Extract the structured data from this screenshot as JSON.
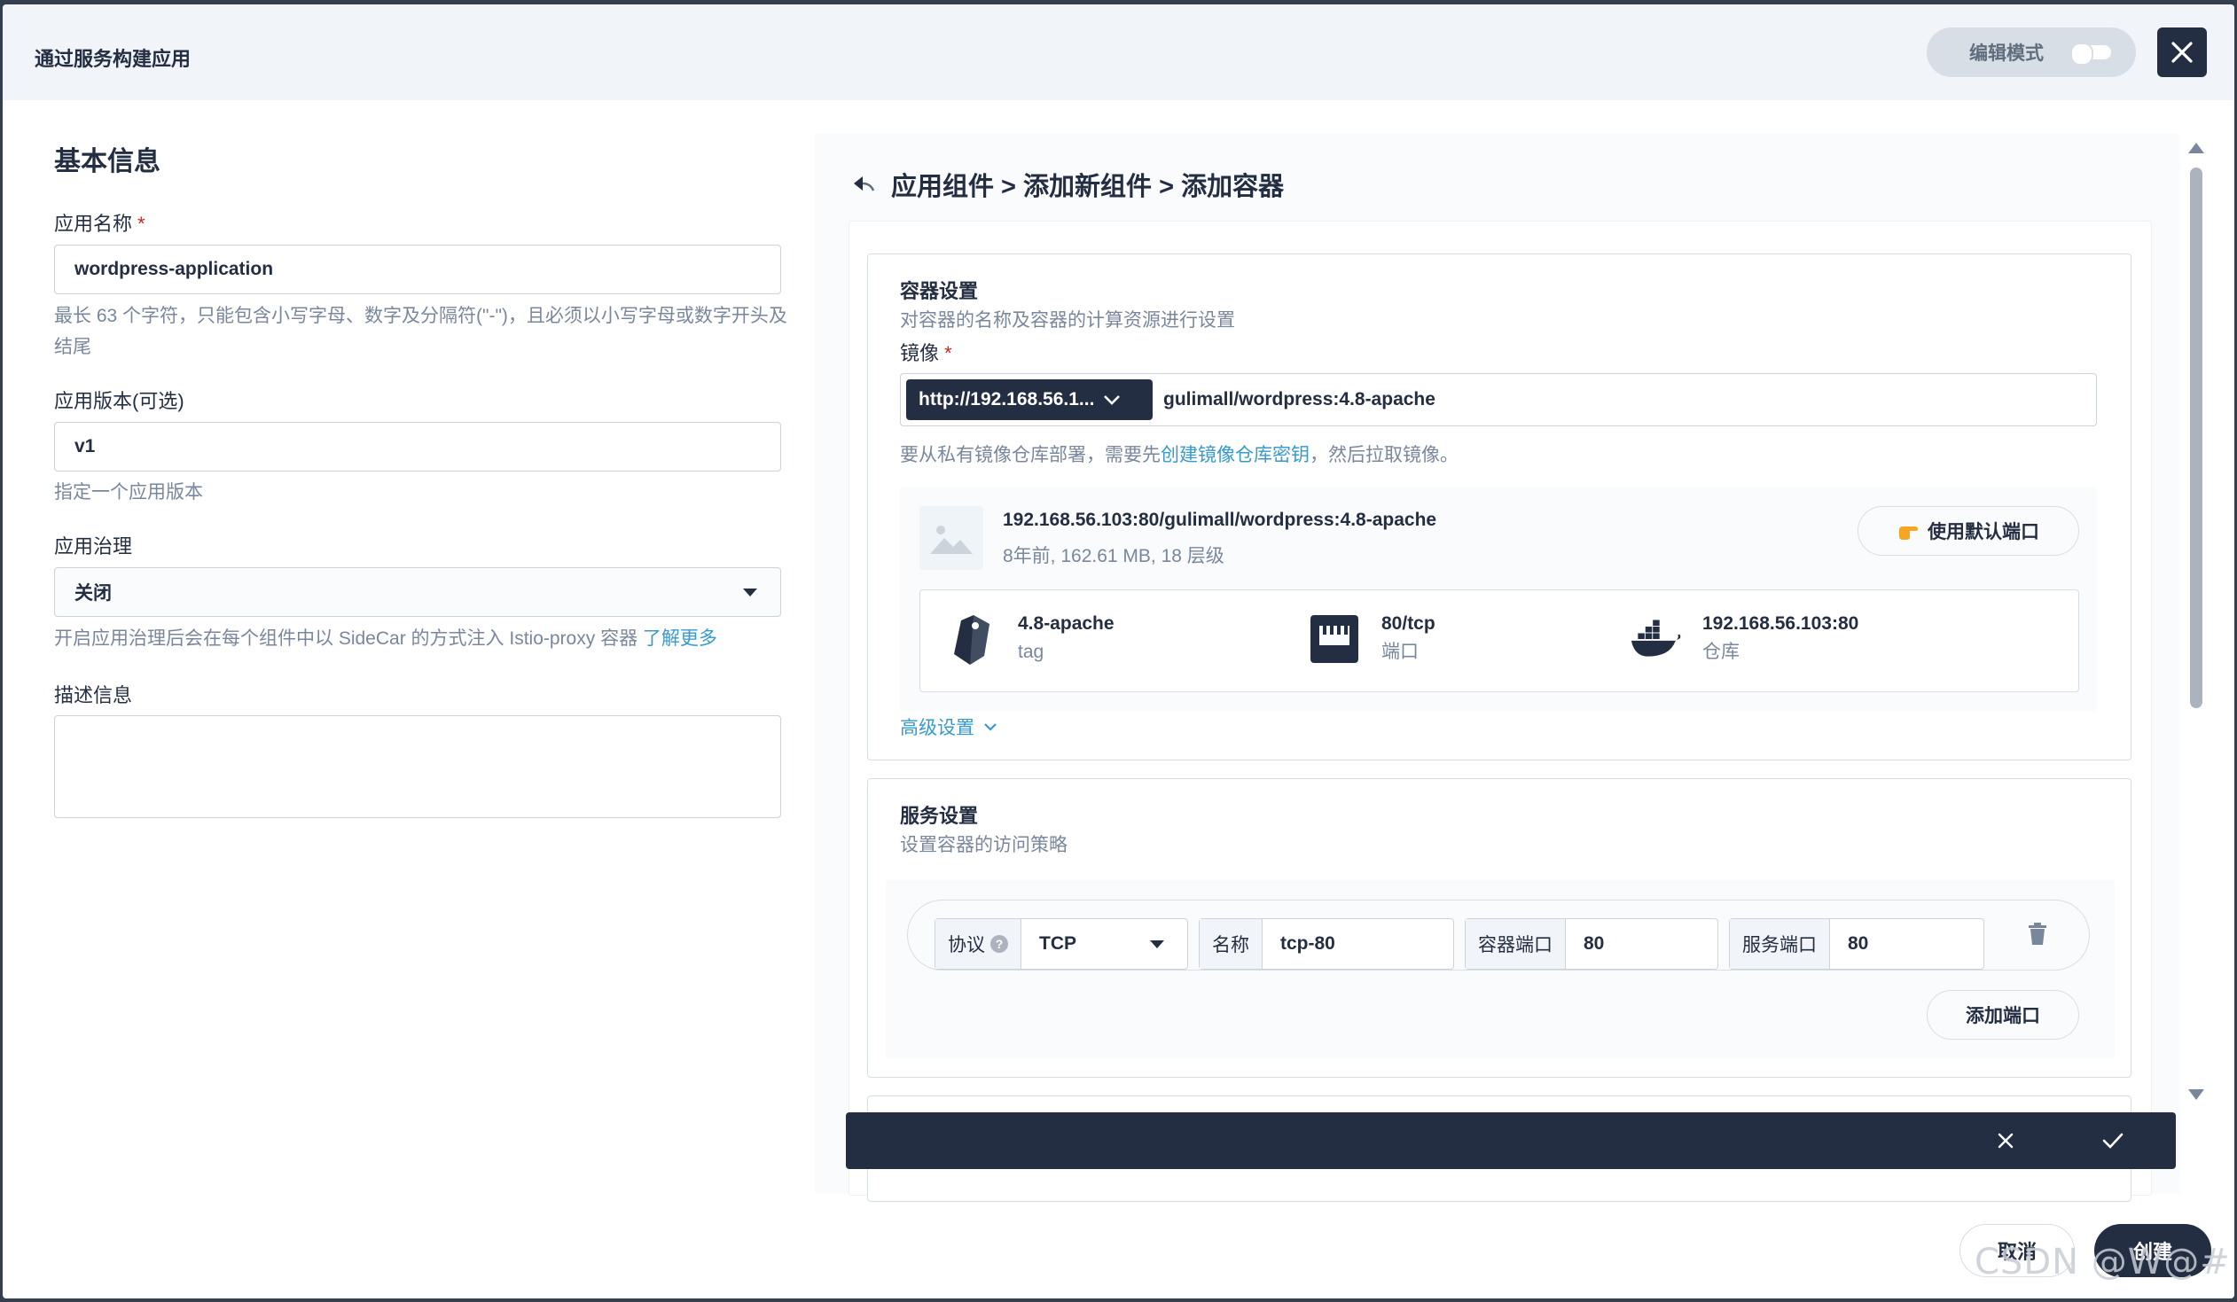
{
  "modal": {
    "title": "通过服务构建应用",
    "edit_mode_label": "编辑模式",
    "edit_mode_on": false,
    "close_icon": "close-icon"
  },
  "basic_info": {
    "section_title": "基本信息",
    "app_name": {
      "label": "应用名称",
      "required_mark": "*",
      "value": "wordpress-application",
      "hint": "最长 63 个字符，只能包含小写字母、数字及分隔符(\"-\")，且必须以小写字母或数字开头及结尾"
    },
    "app_version": {
      "label": "应用版本(可选)",
      "value": "v1",
      "hint": "指定一个应用版本"
    },
    "governance": {
      "label": "应用治理",
      "value": "关闭",
      "hint": "开启应用治理后会在每个组件中以 SideCar 的方式注入 Istio-proxy 容器",
      "learn_more": "了解更多"
    },
    "description": {
      "label": "描述信息",
      "value": ""
    }
  },
  "breadcrumb": {
    "back_icon": "back-arrow-icon",
    "text": "应用组件 > 添加新组件 > 添加容器"
  },
  "container_settings": {
    "title": "容器设置",
    "subtitle": "对容器的名称及容器的计算资源进行设置",
    "image_label": "镜像",
    "required_mark": "*",
    "registry": "http://192.168.56.1...",
    "image_value": "gulimall/wordpress:4.8-apache",
    "hint_prefix": "要从私有镜像仓库部署，需要先",
    "hint_link": "创建镜像仓库密钥",
    "hint_suffix": "，然后拉取镜像。",
    "image_card": {
      "full_name": "192.168.56.103:80/gulimall/wordpress:4.8-apache",
      "meta": "8年前, 162.61 MB, 18 层级",
      "default_port_button": "使用默认端口",
      "tag_value": "4.8-apache",
      "tag_key": "tag",
      "port_value": "80/tcp",
      "port_key": "端口",
      "repo_value": "192.168.56.103:80",
      "repo_key": "仓库"
    },
    "advanced": "高级设置"
  },
  "service_settings": {
    "title": "服务设置",
    "subtitle": "设置容器的访问策略",
    "port_row": {
      "protocol_label": "协议",
      "help": "?",
      "protocol_value": "TCP",
      "name_label": "名称",
      "name_value": "tcp-80",
      "container_port_label": "容器端口",
      "container_port_value": "80",
      "service_port_label": "服务端口",
      "service_port_value": "80"
    },
    "add_port_button": "添加端口"
  },
  "footer": {
    "cancel": "取消",
    "create": "创建"
  },
  "watermark": "CSDN @W@#"
}
